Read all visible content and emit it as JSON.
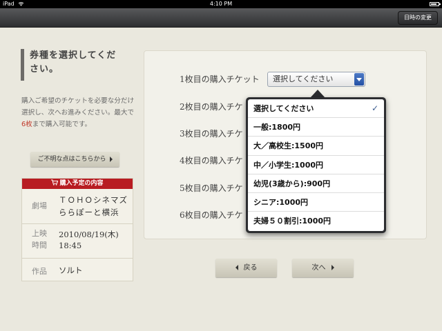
{
  "status_bar": {
    "device": "iPad",
    "time": "4:10 PM",
    "battery_level": 0.8
  },
  "navbar": {
    "change_datetime_label": "日時の変更"
  },
  "left": {
    "title_line1": "券種を選択してくだ",
    "title_line2": "さい。",
    "instructions_part1": "購入ご希望のチケットを必要な分だけ選択し、次へお進みください。最大で",
    "instructions_max": "6枚",
    "instructions_part2": "まで購入可能です。",
    "help_button": "ご不明な点はこちらから",
    "purchase": {
      "header": "購入予定の内容",
      "theater_label": "劇場",
      "theater_line1": "ＴＯＨＯシネマズ",
      "theater_line2": "ららぽーと横浜",
      "showtime_label_line1": "上映",
      "showtime_label_line2": "時間",
      "showtime_date": "2010/08/19(木)",
      "showtime_time": "18:45",
      "movie_label": "作品",
      "movie_title": "ソルト"
    }
  },
  "main": {
    "ticket_rows": [
      {
        "label": "1枚目の購入チケット"
      },
      {
        "label": "2枚目の購入チケ"
      },
      {
        "label": "3枚目の購入チケ"
      },
      {
        "label": "4枚目の購入チケ"
      },
      {
        "label": "5枚目の購入チケ"
      },
      {
        "label": "6枚目の購入チケ"
      }
    ],
    "select_value": "選択してください",
    "dropdown_options": [
      {
        "label": "選択してください",
        "selected": true
      },
      {
        "label": "一般:1800円",
        "selected": false
      },
      {
        "label": "大／高校生:1500円",
        "selected": false
      },
      {
        "label": "中／小学生:1000円",
        "selected": false
      },
      {
        "label": "幼児(3歳から):900円",
        "selected": false
      },
      {
        "label": "シニア:1000円",
        "selected": false
      },
      {
        "label": "夫婦５０割引:1000円",
        "selected": false
      }
    ],
    "check_mark": "✓"
  },
  "footer": {
    "back_label": "戻る",
    "next_label": "次へ"
  },
  "colors": {
    "background": "#eae8de",
    "accent_red": "#b81c22",
    "select_blue": "#2451a5",
    "nav_dark": "#2e2f31"
  }
}
